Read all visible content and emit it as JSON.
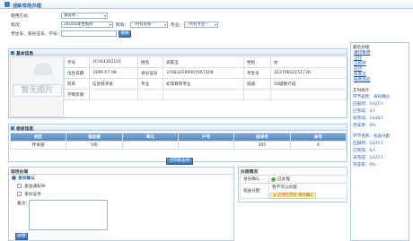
{
  "window": {
    "title": "迎新现场办理"
  },
  "search": {
    "mode_label": "使用方式：",
    "mode_value": "请选择...",
    "batch_label": "批次：",
    "batch_value": "2016年新生报到",
    "college_label": "院系：",
    "college_value": "--所有院系--",
    "major_label": "专业：",
    "major_value": "--所有专业--",
    "id_label": "考生号、身份证号、学号：",
    "id_value": "",
    "search_button": "查询"
  },
  "basic": {
    "title": "基本信息",
    "watermark": "暂无图片",
    "rows": [
      {
        "k1": "学号",
        "v1": "20164302101",
        "k2": "姓名",
        "v2": "高家玉",
        "k3": "性别",
        "v3": "女"
      },
      {
        "k1": "出生日期",
        "v1": "1999-07-08",
        "k2": "身份证号",
        "v2": "370832199907067108",
        "k3": "考生号",
        "v3": "16370832151736"
      },
      {
        "k1": "院系",
        "v1": "信息技术系",
        "k2": "专业",
        "v2": "初等教育专业",
        "k3": "班级",
        "v3": "16级数计班"
      },
      {
        "k1": "学制年限",
        "v1": "",
        "k2": "",
        "v2": "",
        "k3": "",
        "v3": ""
      }
    ]
  },
  "dorm": {
    "title": "宿舍信息",
    "headers": [
      "校区",
      "宿舍楼",
      "单元",
      "户号",
      "房间号",
      "床号"
    ],
    "rows": [
      [
        "怀本部",
        "5栋",
        "",
        "",
        "305",
        "4"
      ]
    ],
    "print_button": "打印宿舍钥"
  },
  "onsite": {
    "title": "现场办理",
    "section": "身份确认",
    "option1": "查验通知书",
    "option2": "身份证件",
    "remark_label": "备注：",
    "submit_button": "办理"
  },
  "status": {
    "title": "办理情况",
    "row1_label": "身份确认",
    "row1_value": "已办理",
    "row2_label": "宿舍分配",
    "row2_value": "暂不可以办理",
    "row2_warn": "必须先完成 身份确认"
  },
  "sidebar": {
    "title": "最近办理",
    "links": [
      "潘印象明",
      "汪玲",
      "王帆宇",
      "刘汐",
      "高家玉",
      "宿费退还"
    ],
    "stats_title": "实时统计",
    "groups": [
      {
        "head": "环节名称：身份确认",
        "lines": [
          "应报到：1437人",
          "已完成：3人",
          "未完成：1434人",
          "完成率：0%"
        ]
      },
      {
        "head": "环节名称：宿舍分配",
        "lines": [
          "应报到：1437人",
          "已完成：0人",
          "未完成：1437人",
          "完成率：0%"
        ]
      }
    ]
  },
  "colors": {
    "accent": "#3c73b2",
    "header_bg": "#dce9f6",
    "link": "#1a56a8",
    "warn": "#e05a00"
  }
}
